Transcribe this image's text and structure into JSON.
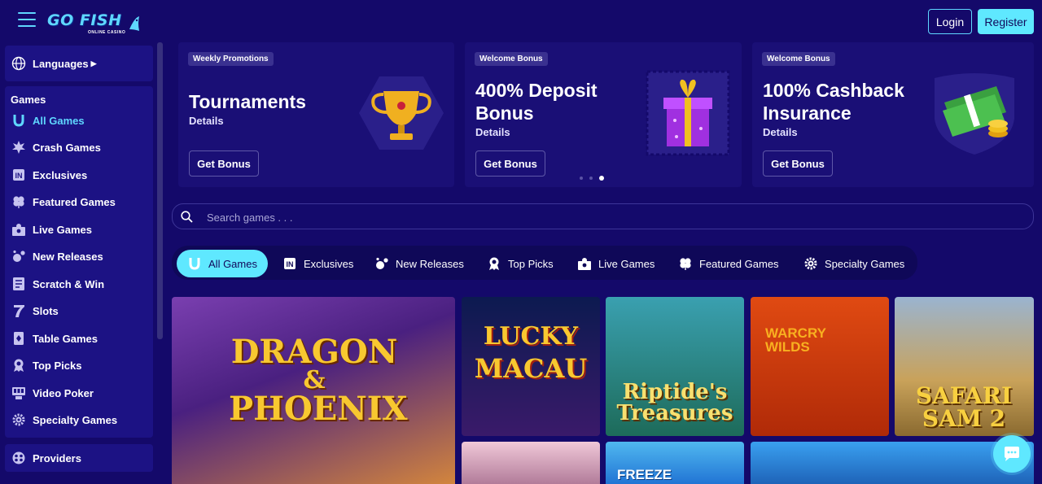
{
  "header": {
    "logo_text": "GO FISH",
    "logo_subtext": "ONLINE CASINO",
    "login_label": "Login",
    "register_label": "Register"
  },
  "sidebar": {
    "languages_label": "Languages",
    "games_heading": "Games",
    "items": [
      {
        "label": "All Games",
        "icon": "horseshoe-icon",
        "active": true
      },
      {
        "label": "Crash Games",
        "icon": "explosion-icon"
      },
      {
        "label": "Exclusives",
        "icon": "exclusive-badge-icon"
      },
      {
        "label": "Featured Games",
        "icon": "clover-icon"
      },
      {
        "label": "Live Games",
        "icon": "dealer-icon"
      },
      {
        "label": "New Releases",
        "icon": "new-sparkle-icon"
      },
      {
        "label": "Scratch & Win",
        "icon": "scratch-card-icon"
      },
      {
        "label": "Slots",
        "icon": "seven-icon"
      },
      {
        "label": "Table Games",
        "icon": "card-icon"
      },
      {
        "label": "Top Picks",
        "icon": "medal-icon"
      },
      {
        "label": "Video Poker",
        "icon": "poker-machine-icon"
      },
      {
        "label": "Specialty Games",
        "icon": "gear-icon"
      }
    ],
    "providers_label": "Providers"
  },
  "promos": [
    {
      "tag": "Weekly Promotions",
      "title_lines": [
        "Tournaments"
      ],
      "details": "Details",
      "button": "Get Bonus",
      "art": "trophy-icon"
    },
    {
      "tag": "Welcome Bonus",
      "title_lines": [
        "400% Deposit",
        "Bonus"
      ],
      "details": "Details",
      "button": "Get Bonus",
      "art": "gift-box-icon"
    },
    {
      "tag": "Welcome Bonus",
      "title_lines": [
        "100% Cashback",
        "Insurance"
      ],
      "details": "Details",
      "button": "Get Bonus",
      "art": "cash-stack-icon"
    }
  ],
  "carousel": {
    "total": 3,
    "active_index": 2
  },
  "search": {
    "placeholder": "Search games . . ."
  },
  "tabs": [
    {
      "label": "All Games",
      "icon": "horseshoe-icon",
      "active": true
    },
    {
      "label": "Exclusives",
      "icon": "exclusive-badge-icon"
    },
    {
      "label": "New Releases",
      "icon": "new-sparkle-icon"
    },
    {
      "label": "Top Picks",
      "icon": "medal-icon"
    },
    {
      "label": "Live Games",
      "icon": "dealer-icon"
    },
    {
      "label": "Featured Games",
      "icon": "clover-icon"
    },
    {
      "label": "Specialty Games",
      "icon": "gear-icon"
    }
  ],
  "games": [
    {
      "title_lines": [
        "DRAGON",
        "&",
        "PHOENIX"
      ],
      "colors": [
        "#7a3fb0",
        "#d98a3a"
      ]
    },
    {
      "title_lines": [
        "LUCKY",
        "MACAU"
      ],
      "colors": [
        "#102060",
        "#3a1a6a"
      ]
    },
    {
      "title_lines": [
        "Riptide's",
        "Treasures"
      ],
      "colors": [
        "#1d6b5a",
        "#3aa0b0"
      ]
    },
    {
      "title_lines": [
        "WARCRY",
        "WILDS"
      ],
      "colors": [
        "#c23a10",
        "#ff7a20"
      ]
    },
    {
      "title_lines": [
        "SAFARI",
        "SAM 2"
      ],
      "colors": [
        "#c9a25a",
        "#7a9ac0"
      ]
    },
    {
      "title_lines": [],
      "colors": [
        "#e8b8c8",
        "#a87090"
      ]
    },
    {
      "title_lines": [
        "FREEZE"
      ],
      "colors": [
        "#1a6ad0",
        "#50b8f0"
      ]
    },
    {
      "title_lines": [],
      "colors": [
        "#3aa0f0",
        "#1a5ab0"
      ]
    }
  ],
  "colors": {
    "accent": "#5fe8ff",
    "background": "#14096a",
    "panel": "#1c1284"
  }
}
